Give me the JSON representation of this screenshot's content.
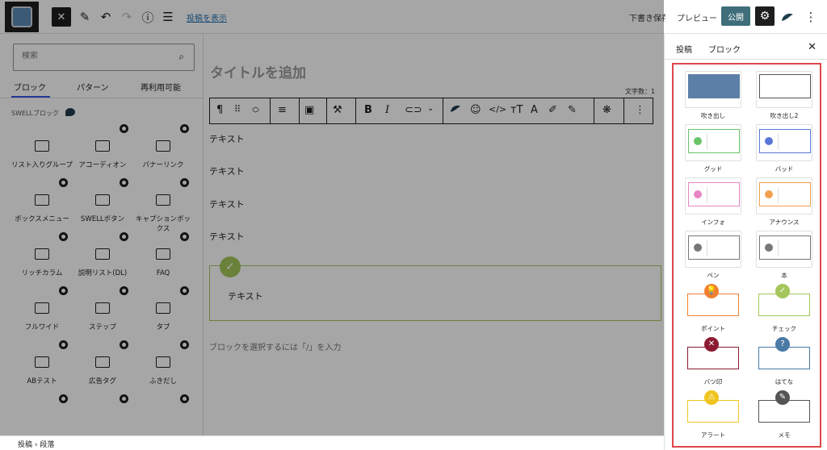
{
  "header": {
    "view_post_link": "投稿を表示",
    "draft_label": "下書き保存",
    "preview_label": "プレビュー",
    "publish_label": "公開"
  },
  "inserter": {
    "search_placeholder": "検索",
    "tabs": [
      "ブロック",
      "パターン",
      "再利用可能"
    ],
    "section_title": "SWELLブロック",
    "blocks": [
      {
        "label": "リスト入りグループ",
        "icon": "list-box-icon"
      },
      {
        "label": "アコーディオン",
        "icon": "accordion-icon"
      },
      {
        "label": "バナーリンク",
        "icon": "image-icon"
      },
      {
        "label": "ボックスメニュー",
        "icon": "grid-menu-icon"
      },
      {
        "label": "SWELLボタン",
        "icon": "button-icon"
      },
      {
        "label": "キャプションボックス",
        "icon": "caption-box-icon"
      },
      {
        "label": "リッチカラム",
        "icon": "columns-icon"
      },
      {
        "label": "説明リスト(DL)",
        "icon": "description-list-icon"
      },
      {
        "label": "FAQ",
        "icon": "faq-icon"
      },
      {
        "label": "フルワイド",
        "icon": "full-wide-icon"
      },
      {
        "label": "ステップ",
        "icon": "step-icon"
      },
      {
        "label": "タブ",
        "icon": "tab-icon"
      },
      {
        "label": "ABテスト",
        "icon": "ab-test-icon"
      },
      {
        "label": "広告タグ",
        "icon": "ad-tag-icon"
      },
      {
        "label": "ふきだし",
        "icon": "balloon-icon"
      }
    ]
  },
  "editor": {
    "title_placeholder": "タイトルを追加",
    "word_count": "文字数：1",
    "paragraphs": [
      "テキスト",
      "テキスト",
      "テキスト",
      "テキスト"
    ],
    "checkbox_text": "テキスト",
    "append_hint": "ブロックを選択するには「/」を入力"
  },
  "sidebar": {
    "tabs": [
      "投稿",
      "ブロック"
    ],
    "styles": [
      {
        "label": "吹き出し",
        "color": "#5b7fa6"
      },
      {
        "label": "吹き出し2",
        "color": "#555555"
      },
      {
        "label": "グッド",
        "color": "#6ac46a"
      },
      {
        "label": "バッド",
        "color": "#5a76d6"
      },
      {
        "label": "インフォ",
        "color": "#e586c2"
      },
      {
        "label": "アナウンス",
        "color": "#f0a050"
      },
      {
        "label": "ペン",
        "color": "#777777"
      },
      {
        "label": "本",
        "color": "#777777"
      },
      {
        "label": "ポイント",
        "color": "#f08030"
      },
      {
        "label": "チェック",
        "color": "#a4c65a"
      },
      {
        "label": "バツ印",
        "color": "#8c1a30"
      },
      {
        "label": "はてな",
        "color": "#4a7aa6"
      },
      {
        "label": "アラート",
        "color": "#f0c520"
      },
      {
        "label": "メモ",
        "color": "#555555"
      }
    ]
  },
  "statusbar": {
    "breadcrumb": "投稿 › 段落"
  }
}
